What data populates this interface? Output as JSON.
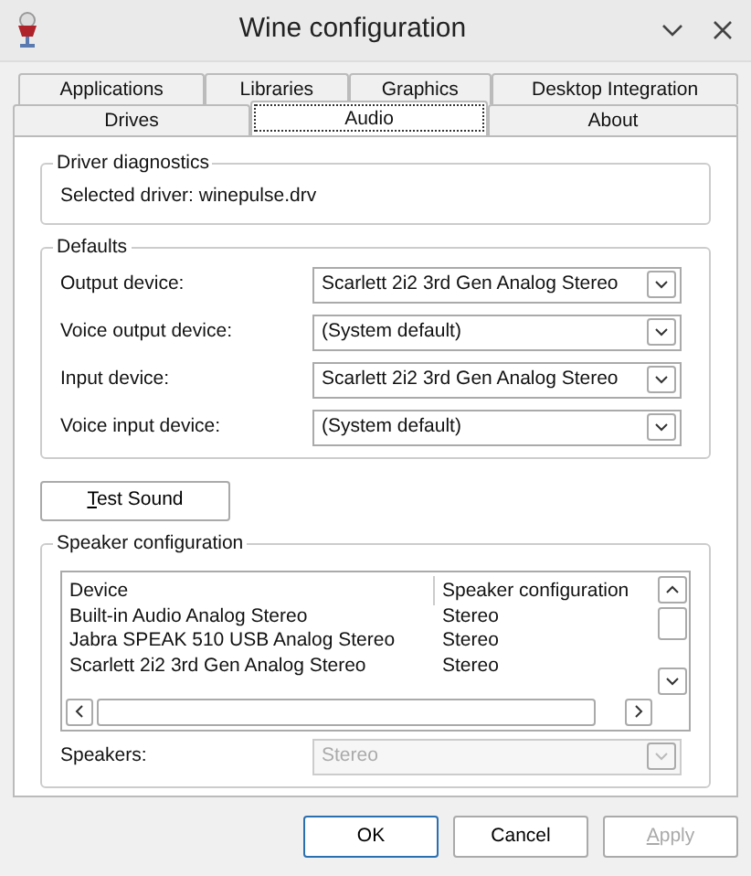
{
  "window": {
    "title": "Wine configuration"
  },
  "tab_rows": [
    [
      {
        "label": "Applications",
        "selected": false
      },
      {
        "label": "Libraries",
        "selected": false
      },
      {
        "label": "Graphics",
        "selected": false
      },
      {
        "label": "Desktop Integration",
        "selected": false
      }
    ],
    [
      {
        "label": "Drives",
        "selected": false
      },
      {
        "label": "Audio",
        "selected": true
      },
      {
        "label": "About",
        "selected": false
      }
    ]
  ],
  "driver_diagnostics": {
    "title": "Driver diagnostics",
    "text": "Selected driver: winepulse.drv"
  },
  "defaults": {
    "title": "Defaults",
    "rows": [
      {
        "label": "Output device:",
        "value": "Scarlett 2i2 3rd Gen Analog Stereo"
      },
      {
        "label": "Voice output device:",
        "value": "(System default)"
      },
      {
        "label": "Input device:",
        "value": "Scarlett 2i2 3rd Gen Analog Stereo"
      },
      {
        "label": "Voice input device:",
        "value": "(System default)"
      }
    ]
  },
  "test_sound": {
    "label": "Test Sound"
  },
  "speaker_configuration": {
    "title": "Speaker configuration",
    "columns": [
      "Device",
      "Speaker configuration"
    ],
    "rows": [
      [
        "Built-in Audio Analog Stereo",
        "Stereo"
      ],
      [
        "Jabra SPEAK 510 USB Analog Stereo",
        "Stereo"
      ],
      [
        "Scarlett 2i2 3rd Gen Analog Stereo",
        "Stereo"
      ]
    ],
    "speakers": {
      "label": "Speakers:",
      "value": "Stereo",
      "disabled": true
    }
  },
  "buttons": [
    {
      "label": "OK",
      "default": true,
      "disabled": false
    },
    {
      "label": "Cancel",
      "default": false,
      "disabled": false
    },
    {
      "label": "Apply",
      "default": false,
      "disabled": true
    }
  ]
}
